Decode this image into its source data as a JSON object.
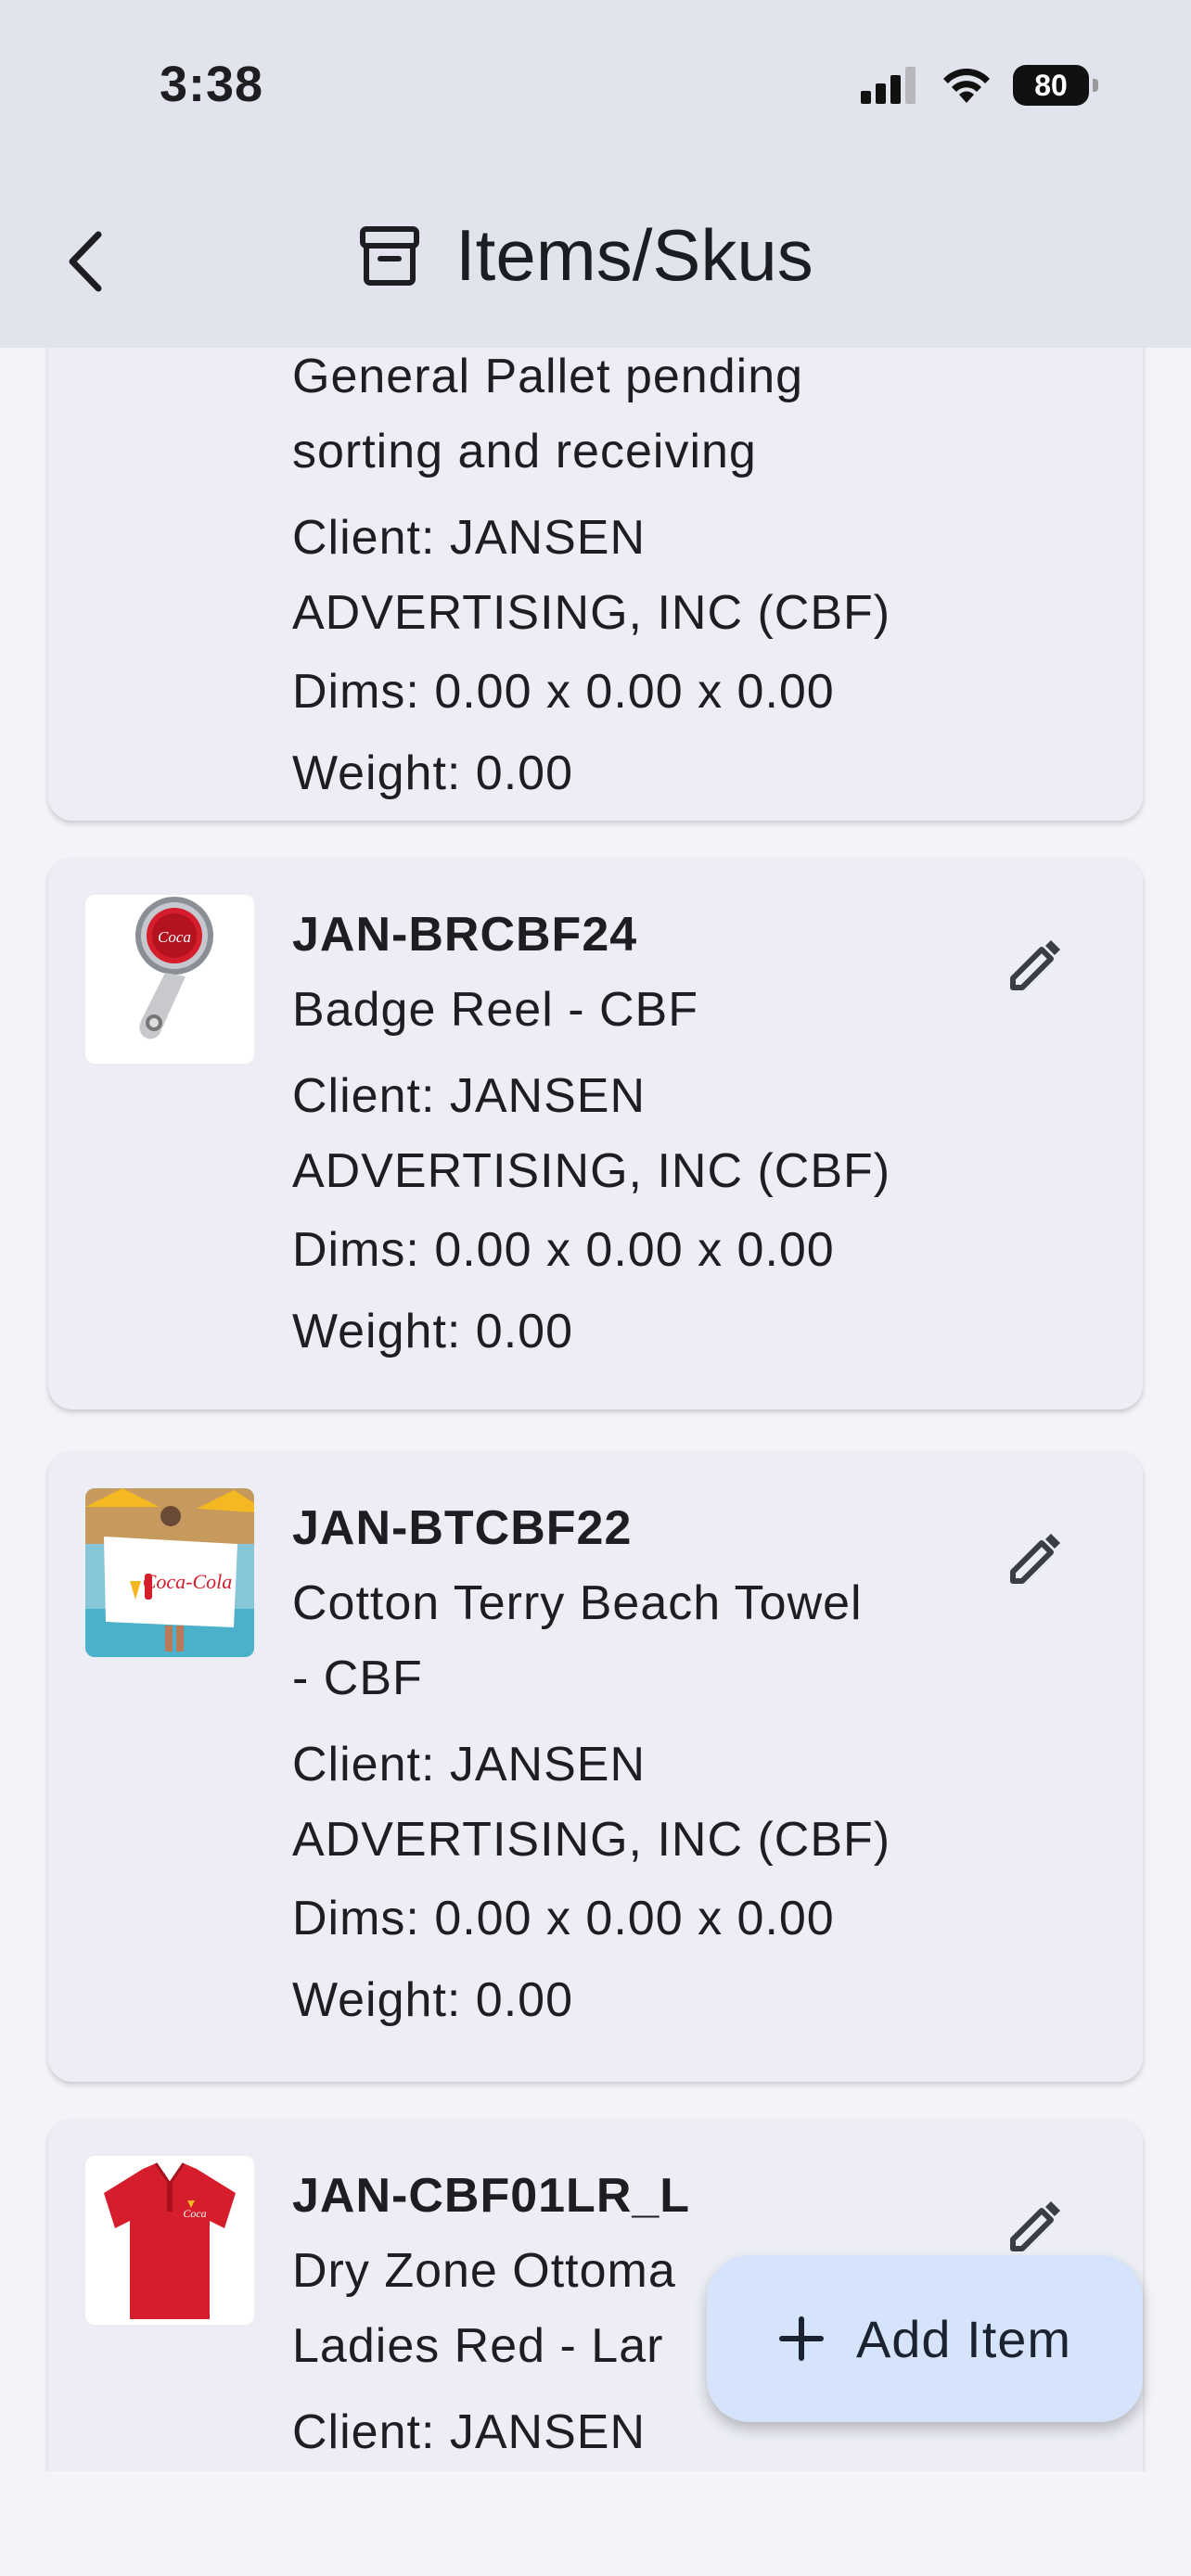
{
  "status_bar": {
    "time": "3:38",
    "battery": "80"
  },
  "header": {
    "title": "Items/Skus"
  },
  "items": [
    {
      "description_lines": [
        "General Pallet pending",
        "sorting and receiving"
      ],
      "client_lines": [
        "Client: JANSEN",
        "ADVERTISING, INC (CBF)"
      ],
      "dims": "Dims: 0.00 x 0.00 x 0.00",
      "weight": "Weight: 0.00"
    },
    {
      "sku": "JAN-BRCBF24",
      "description_lines": [
        "Badge Reel - CBF"
      ],
      "client_lines": [
        "Client: JANSEN",
        "ADVERTISING, INC (CBF)"
      ],
      "dims": "Dims: 0.00 x 0.00 x 0.00",
      "weight": "Weight: 0.00",
      "image_icon": "badge-reel-image"
    },
    {
      "sku": "JAN-BTCBF22",
      "description_lines": [
        "Cotton Terry Beach Towel",
        "- CBF"
      ],
      "client_lines": [
        "Client: JANSEN",
        "ADVERTISING, INC (CBF)"
      ],
      "dims": "Dims: 0.00 x 0.00 x 0.00",
      "weight": "Weight: 0.00",
      "image_icon": "beach-towel-image"
    },
    {
      "sku": "JAN-CBF01LR_L",
      "description_lines": [
        "Dry Zone Ottoma",
        "Ladies Red - Lar"
      ],
      "client_lines": [
        "Client: JANSEN"
      ],
      "image_icon": "red-polo-image"
    }
  ],
  "fab": {
    "label": "Add Item",
    "icon": "plus-icon"
  },
  "colors": {
    "header_bg": "#e1e4ec",
    "page_bg": "#f3f4f9",
    "card_bg": "#ecedf5",
    "fab_bg": "#d6e4fb",
    "brand_red": "#d51d2b"
  }
}
